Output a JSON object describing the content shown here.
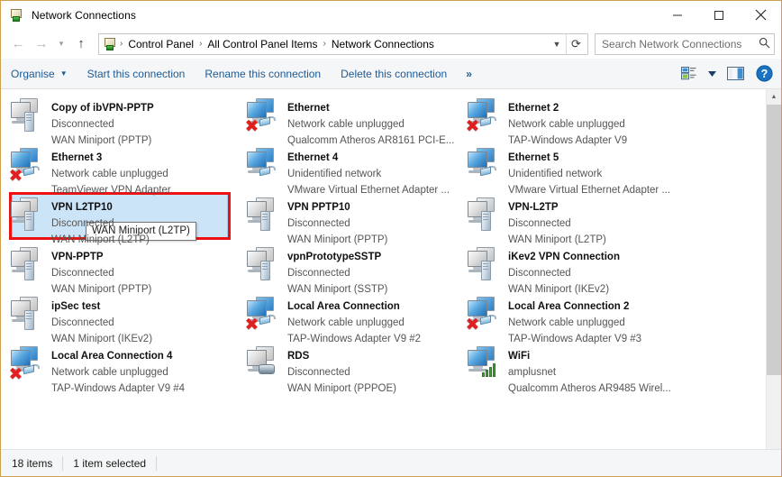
{
  "window": {
    "title": "Network Connections",
    "title_icon": "network-connections-icon",
    "minimize_label": "Minimize",
    "maximize_label": "Maximize",
    "close_label": "Close"
  },
  "address_bar": {
    "back_label": "Back",
    "forward_label": "Forward",
    "recent_label": "Recent locations",
    "up_label": "Up",
    "crumbs": [
      "Control Panel",
      "All Control Panel Items",
      "Network Connections"
    ],
    "separator": "›",
    "dropdown_label": "Previous locations",
    "refresh_label": "Refresh",
    "search_placeholder": "Search Network Connections",
    "search_value": "",
    "search_icon": "search-icon"
  },
  "command_bar": {
    "organise_label": "Organise",
    "organise_caret": "▼",
    "start_label": "Start this connection",
    "rename_label": "Rename this connection",
    "delete_label": "Delete this connection",
    "overflow_label": "»",
    "view_icon": "view-layout-icon",
    "view_caret": "▼",
    "preview_pane_icon": "preview-pane-icon",
    "help_icon": "help-icon",
    "help_glyph": "?"
  },
  "connections": [
    {
      "name": "Copy of ibVPN-PPTP",
      "status": "Disconnected",
      "device": "WAN Miniport (PPTP)",
      "icon": "vpn-connection-icon",
      "screen": "grey",
      "badge": "tower",
      "error": false,
      "selected": false
    },
    {
      "name": "Ethernet",
      "status": "Network cable unplugged",
      "device": "Qualcomm Atheros AR8161 PCI-E...",
      "icon": "ethernet-icon",
      "screen": "blue",
      "badge": "plug",
      "error": true,
      "selected": false
    },
    {
      "name": "Ethernet 2",
      "status": "Network cable unplugged",
      "device": "TAP-Windows Adapter V9",
      "icon": "ethernet-icon",
      "screen": "blue",
      "badge": "plug",
      "error": true,
      "selected": false
    },
    {
      "name": "Ethernet 3",
      "status": "Network cable unplugged",
      "device": "TeamViewer VPN Adapter",
      "icon": "ethernet-icon",
      "screen": "blue",
      "badge": "plug",
      "error": true,
      "selected": false
    },
    {
      "name": "Ethernet 4",
      "status": "Unidentified network",
      "device": "VMware Virtual Ethernet Adapter ...",
      "icon": "ethernet-icon",
      "screen": "blue",
      "badge": "plug",
      "error": false,
      "selected": false
    },
    {
      "name": "Ethernet 5",
      "status": "Unidentified network",
      "device": "VMware Virtual Ethernet Adapter ...",
      "icon": "ethernet-icon",
      "screen": "blue",
      "badge": "plug",
      "error": false,
      "selected": false
    },
    {
      "name": "VPN L2TP10",
      "status": "Disconnected",
      "device": "WAN Miniport (L2TP)",
      "icon": "vpn-connection-icon",
      "screen": "grey",
      "badge": "tower",
      "error": false,
      "selected": true
    },
    {
      "name": "VPN PPTP10",
      "status": "Disconnected",
      "device": "WAN Miniport (PPTP)",
      "icon": "vpn-connection-icon",
      "screen": "grey",
      "badge": "tower",
      "error": false,
      "selected": false
    },
    {
      "name": "VPN-L2TP",
      "status": "Disconnected",
      "device": "WAN Miniport (L2TP)",
      "icon": "vpn-connection-icon",
      "screen": "grey",
      "badge": "tower",
      "error": false,
      "selected": false
    },
    {
      "name": "VPN-PPTP",
      "status": "Disconnected",
      "device": "WAN Miniport (PPTP)",
      "icon": "vpn-connection-icon",
      "screen": "grey",
      "badge": "tower",
      "error": false,
      "selected": false
    },
    {
      "name": "vpnPrototypeSSTP",
      "status": "Disconnected",
      "device": "WAN Miniport (SSTP)",
      "icon": "vpn-connection-icon",
      "screen": "grey",
      "badge": "tower",
      "error": false,
      "selected": false
    },
    {
      "name": "iKev2 VPN Connection",
      "status": "Disconnected",
      "device": "WAN Miniport (IKEv2)",
      "icon": "vpn-connection-icon",
      "screen": "grey",
      "badge": "tower",
      "error": false,
      "selected": false
    },
    {
      "name": "ipSec test",
      "status": "Disconnected",
      "device": "WAN Miniport (IKEv2)",
      "icon": "vpn-connection-icon",
      "screen": "grey",
      "badge": "tower",
      "error": false,
      "selected": false
    },
    {
      "name": "Local Area Connection",
      "status": "Network cable unplugged",
      "device": "TAP-Windows Adapter V9 #2",
      "icon": "ethernet-icon",
      "screen": "blue",
      "badge": "plug",
      "error": true,
      "selected": false
    },
    {
      "name": "Local Area Connection 2",
      "status": "Network cable unplugged",
      "device": "TAP-Windows Adapter V9 #3",
      "icon": "ethernet-icon",
      "screen": "blue",
      "badge": "plug",
      "error": true,
      "selected": false
    },
    {
      "name": "Local Area Connection 4",
      "status": "Network cable unplugged",
      "device": "TAP-Windows Adapter V9 #4",
      "icon": "ethernet-icon",
      "screen": "blue",
      "badge": "plug",
      "error": true,
      "selected": false
    },
    {
      "name": "RDS",
      "status": "Disconnected",
      "device": "WAN Miniport (PPPOE)",
      "icon": "broadband-connection-icon",
      "screen": "grey",
      "badge": "modem",
      "error": false,
      "selected": false
    },
    {
      "name": "WiFi",
      "status": "amplusnet",
      "device": "Qualcomm Atheros AR9485 Wirel...",
      "icon": "wifi-connection-icon",
      "screen": "blue",
      "badge": "wifi",
      "error": false,
      "selected": false
    }
  ],
  "tooltip": {
    "text": "WAN Miniport (L2TP)"
  },
  "highlight": {
    "color": "#ee1111"
  },
  "status_bar": {
    "item_count": "18 items",
    "selection": "1 item selected"
  },
  "scrollbar": {
    "up_glyph": "▲",
    "down_glyph": "▼"
  }
}
